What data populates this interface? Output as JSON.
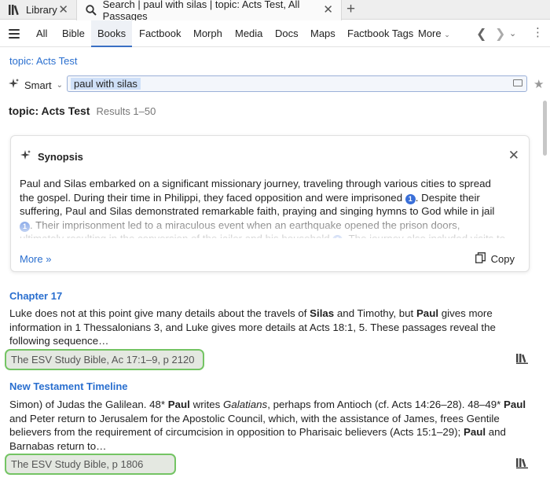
{
  "tabs": [
    {
      "label": "Library",
      "icon": "library-icon"
    },
    {
      "label": "Search | paul with silas | topic: Acts Test, All Passages",
      "icon": "search-icon"
    }
  ],
  "nav": {
    "items": [
      "All",
      "Bible",
      "Books",
      "Factbook",
      "Morph",
      "Media",
      "Docs",
      "Maps",
      "Factbook Tags"
    ],
    "active": "Books",
    "more_label": "More"
  },
  "topic_link": "topic: Acts Test",
  "search": {
    "mode_label": "Smart",
    "query": "paul with silas"
  },
  "results_header": {
    "title": "topic: Acts Test",
    "count": "Results 1–50"
  },
  "synopsis": {
    "title": "Synopsis",
    "paragraph": [
      {
        "t": "Paul and Silas embarked on a significant missionary journey, traveling through various cities to spread the gospel. During their time in Philippi, they faced opposition and were imprisoned "
      },
      {
        "cite": "1"
      },
      {
        "t": ". Despite their suffering, Paul and Silas demonstrated remarkable faith, praying and singing hymns to God while in jail "
      },
      {
        "cite": "1"
      },
      {
        "t": ". Their imprisonment led to a miraculous event when an earthquake opened the prison doors, ultimately resulting in the conversion of the jailer and his household "
      },
      {
        "cite": "1"
      },
      {
        "t": ". The journey also included visits to other cities such as"
      }
    ],
    "more_label": "More »",
    "copy_label": "Copy"
  },
  "results": [
    {
      "title": "Chapter 17",
      "text": [
        {
          "t": "Luke does not at this point give many details about the travels of "
        },
        {
          "b": "Silas"
        },
        {
          "t": " and Timothy, but "
        },
        {
          "b": "Paul"
        },
        {
          "t": " gives more information in 1 Thessalonians 3, and Luke gives more details at Acts 18:1, 5. These passages reveal the following sequence…"
        }
      ],
      "source": "The ESV Study Bible, Ac 17:1–9, p 2120"
    },
    {
      "title": "New Testament Timeline",
      "text": [
        {
          "t": "Simon) of Judas the Galilean. 48* "
        },
        {
          "b": "Paul"
        },
        {
          "t": " writes "
        },
        {
          "i": "Galatians"
        },
        {
          "t": ", perhaps from Antioch (cf. Acts 14:26–28). 48–49* "
        },
        {
          "b": "Paul"
        },
        {
          "t": " and Peter return to Jerusalem for the Apostolic Council, which, with the assistance of James, frees Gentile believers from the requirement of circumcision in opposition to Pharisaic believers (Acts 15:1–29); "
        },
        {
          "b": "Paul"
        },
        {
          "t": " and Barnabas return to…"
        }
      ],
      "source": "The ESV Study Bible, p 1806"
    }
  ],
  "colors": {
    "link": "#2a6fcf",
    "highlight_border": "#74c464",
    "citation": "#3a6fd8"
  }
}
